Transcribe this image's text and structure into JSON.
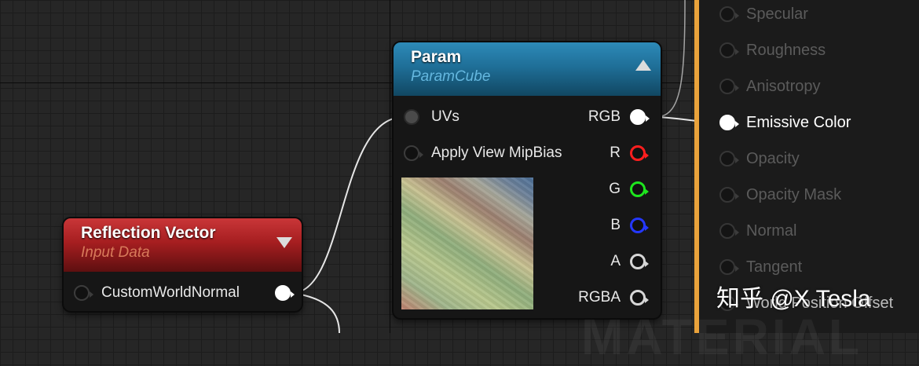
{
  "nodes": {
    "param": {
      "title": "Param",
      "subtitle": "ParamCube",
      "inputs": [
        "UVs",
        "Apply View MipBias"
      ],
      "outputs": [
        "RGB",
        "R",
        "G",
        "B",
        "A",
        "RGBA"
      ]
    },
    "reflection": {
      "title": "Reflection Vector",
      "subtitle": "Input Data",
      "input": "CustomWorldNormal"
    }
  },
  "result_pins": [
    "Specular",
    "Roughness",
    "Anisotropy",
    "Emissive Color",
    "Opacity",
    "Opacity Mask",
    "Normal",
    "Tangent",
    "World Position Offset"
  ],
  "background_watermark": "MATERIAL",
  "watermark": "知乎 @X Tesla",
  "colors": {
    "param_header": "#1f6f98",
    "reflection_header": "#b02224",
    "result_border": "#e9a23b",
    "pin_red": "#ff1e1e",
    "pin_green": "#1ee51e",
    "pin_blue": "#2438ff"
  }
}
